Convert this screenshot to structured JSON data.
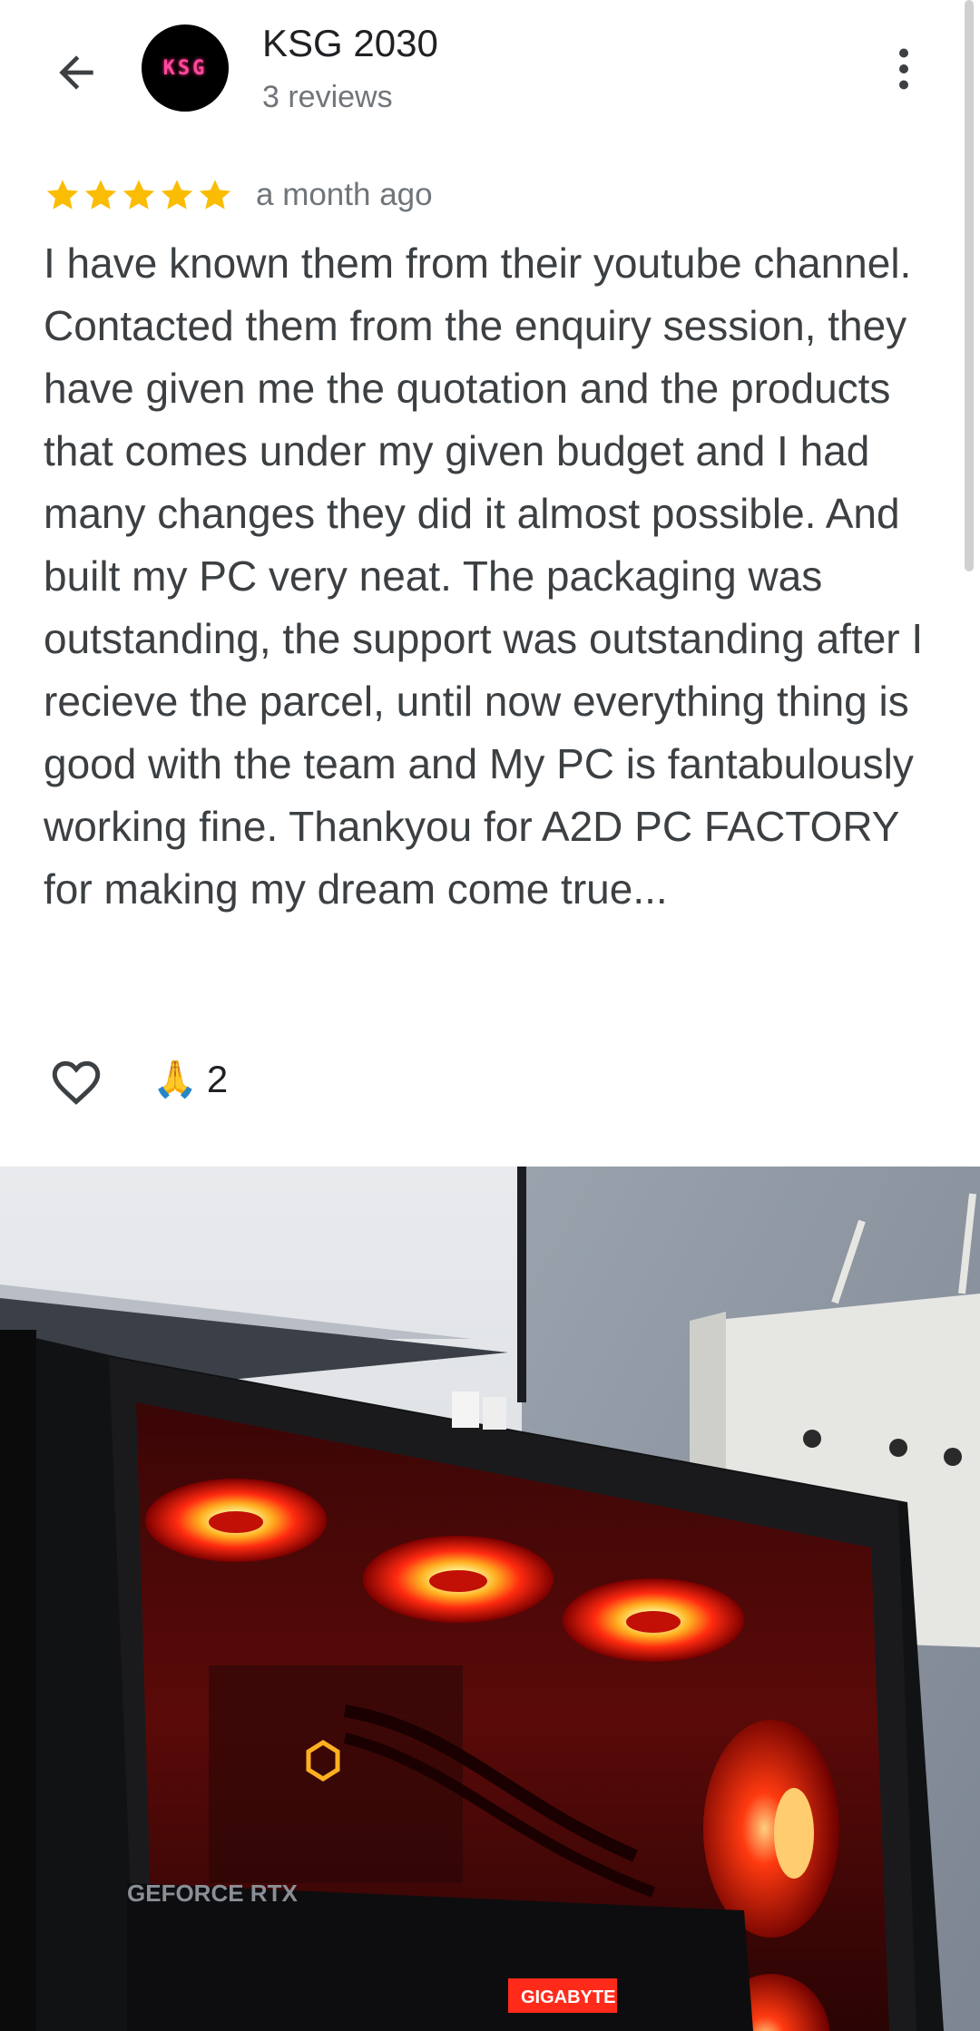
{
  "header": {
    "reviewer_name": "KSG 2030",
    "review_count": "3 reviews",
    "avatar_text": "KSG",
    "back_icon": "arrow-back-icon",
    "more_icon": "more-vert-icon"
  },
  "review": {
    "rating": 5,
    "max_rating": 5,
    "time": "a month ago",
    "text": "I have known them from their youtube channel. Contacted them from the enquiry session, they have given me the quotation and the products that comes under my given budget and I had many changes they did it almost possible. And built my PC very neat. The packaging was outstanding, the support was outstanding after I recieve the parcel, until now everything thing is good with the team and My PC is fantabulously working fine. Thankyou for A2D PC FACTORY for making my dream come true..."
  },
  "reactions": {
    "like_icon": "heart-outline-icon",
    "emoji": "🙏",
    "count": "2"
  },
  "photo": {
    "gpu_label": "GEFORCE RTX",
    "brand_label": "GIGABYTE",
    "icon": "pc-case-photo"
  },
  "colors": {
    "star": "#fbbc04",
    "secondary_text": "#70757a",
    "body_text": "#3c4043",
    "accent_red": "#ff2a1a"
  }
}
